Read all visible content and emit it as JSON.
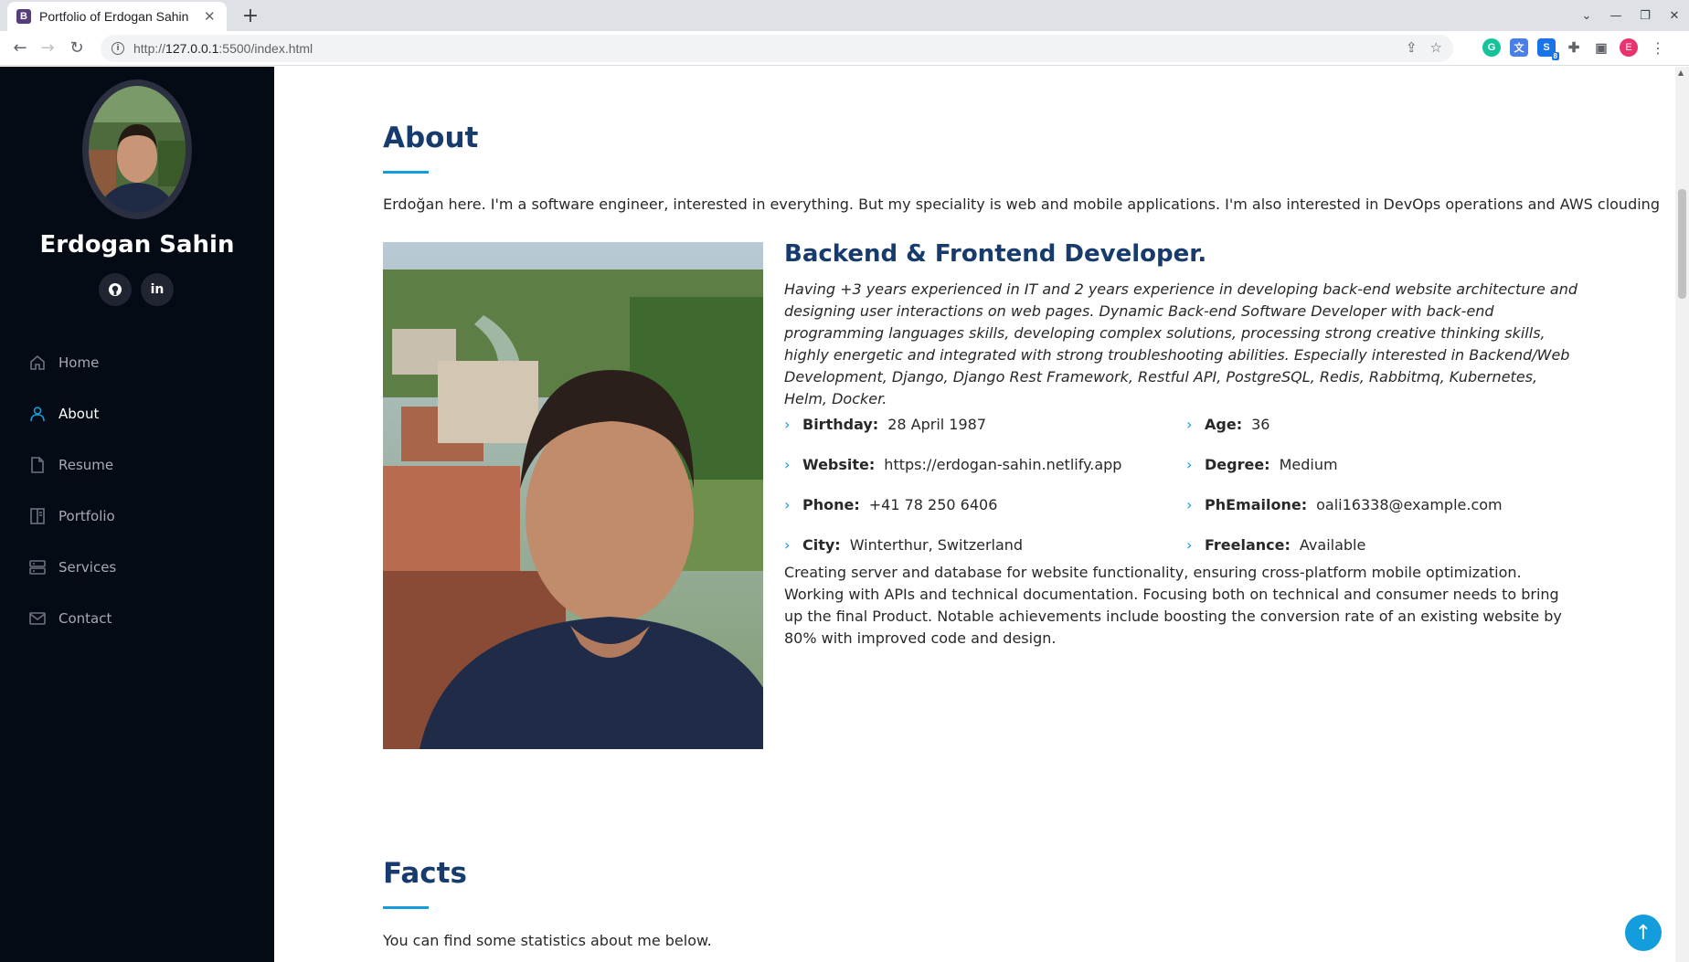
{
  "browser": {
    "tab_title": "Portfolio of Erdogan Sahin",
    "favicon_letter": "B",
    "url_prefix": "http://",
    "url_host": "127.0.0.1",
    "url_rest": ":5500/index.html",
    "profile_letter": "E",
    "extension_badge": "8"
  },
  "sidebar": {
    "name": "Erdogan Sahin",
    "socials": [
      {
        "icon": "github-icon",
        "glyph": "◉"
      },
      {
        "icon": "linkedin-icon",
        "glyph": "in"
      }
    ],
    "nav": [
      {
        "label": "Home",
        "icon": "home-icon"
      },
      {
        "label": "About",
        "icon": "person-icon",
        "active": true
      },
      {
        "label": "Resume",
        "icon": "file-icon"
      },
      {
        "label": "Portfolio",
        "icon": "book-icon"
      },
      {
        "label": "Services",
        "icon": "server-icon"
      },
      {
        "label": "Contact",
        "icon": "envelope-icon"
      }
    ]
  },
  "about": {
    "title": "About",
    "lead": "Erdoğan here. I'm a software engineer, interested in everything. But my speciality is web and mobile applications. I'm also interested in DevOps operations and AWS clouding",
    "role": "Backend & Frontend Developer.",
    "intro": "Having +3 years experienced in IT and 2 years experience in developing back-end website architecture and designing user interactions on web pages. Dynamic Back-end Software Developer with back-end programming languages skills, developing complex solutions, processing strong creative thinking skills, highly energetic and integrated with strong troubleshooting abilities. Especially interested in Backend/Web Development, Django, Django Rest Framework, Restful API, PostgreSQL, Redis, Rabbitmq, Kubernetes, Helm, Docker.",
    "details": {
      "birthday_label": "Birthday:",
      "birthday": "28 April 1987",
      "age_label": "Age:",
      "age": "36",
      "website_label": "Website:",
      "website": "https://erdogan-sahin.netlify.app",
      "degree_label": "Degree:",
      "degree": "Medium",
      "phone_label": "Phone:",
      "phone": "+41 78 250 6406",
      "email_label": "PhEmailone:",
      "email": "oali16338@example.com",
      "city_label": "City:",
      "city": "Winterthur, Switzerland",
      "freelance_label": "Freelance:",
      "freelance": "Available"
    },
    "description": "Creating server and database for website functionality, ensuring cross-platform mobile optimization. Working with APIs and technical documentation. Focusing both on technical and consumer needs to bring up the final Product. Notable achievements include boosting the conversion rate of an existing website by 80% with improved code and design."
  },
  "facts": {
    "title": "Facts",
    "lead": "You can find some statistics about me below."
  },
  "colors": {
    "accent": "#149ddd",
    "heading": "#173b6c",
    "sidebar_bg": "#040b14"
  }
}
